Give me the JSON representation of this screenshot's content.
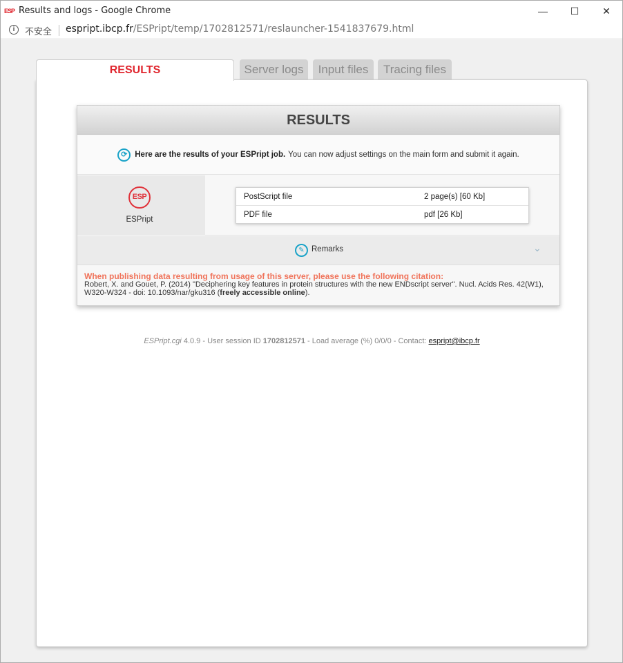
{
  "window": {
    "title": "Results and logs - Google Chrome",
    "favicon": "ESP",
    "minimize": "—",
    "maximize": "☐",
    "close": "✕"
  },
  "address": {
    "security": "不安全",
    "host": "espript.ibcp.fr",
    "path": "/ESPript/temp/1702812571/reslauncher-1541837679.html"
  },
  "tabs": [
    {
      "label": "RESULTS"
    },
    {
      "label": "Server logs"
    },
    {
      "label": "Input files"
    },
    {
      "label": "Tracing files"
    }
  ],
  "card": {
    "title": "RESULTS",
    "intro_bold": "Here are the results of your ESPript job.",
    "intro_text": "You can now adjust settings on the main form and submit it again.",
    "logo_text": "ESP",
    "logo_label": "ESPript",
    "files": [
      {
        "name": "PostScript file",
        "size": "2 page(s) [60 Kb]"
      },
      {
        "name": "PDF file",
        "size": "pdf [26 Kb]"
      }
    ],
    "remarks_label": "Remarks",
    "citation_head": "When publishing data resulting from usage of this server, please use the following citation:",
    "citation_text": "Robert, X. and Gouet, P. (2014) \"Deciphering key features in protein structures with the new ENDscript server\". Nucl. Acids Res. 42(W1), W320-W324 - doi: 10.1093/nar/gku316 (",
    "citation_bold": "freely accessible online",
    "citation_end": ")."
  },
  "footer": {
    "app": "ESPript.cgi",
    "version": "4.0.9 - User session ID",
    "session": "1702812571",
    "load": "- Load average (%) 0/0/0 - Contact:",
    "email": "espript@ibcp.fr"
  },
  "colors": {
    "accent_red": "#e0262e",
    "icon_blue": "#1aa3c8",
    "citation_orange": "#f0735a"
  }
}
